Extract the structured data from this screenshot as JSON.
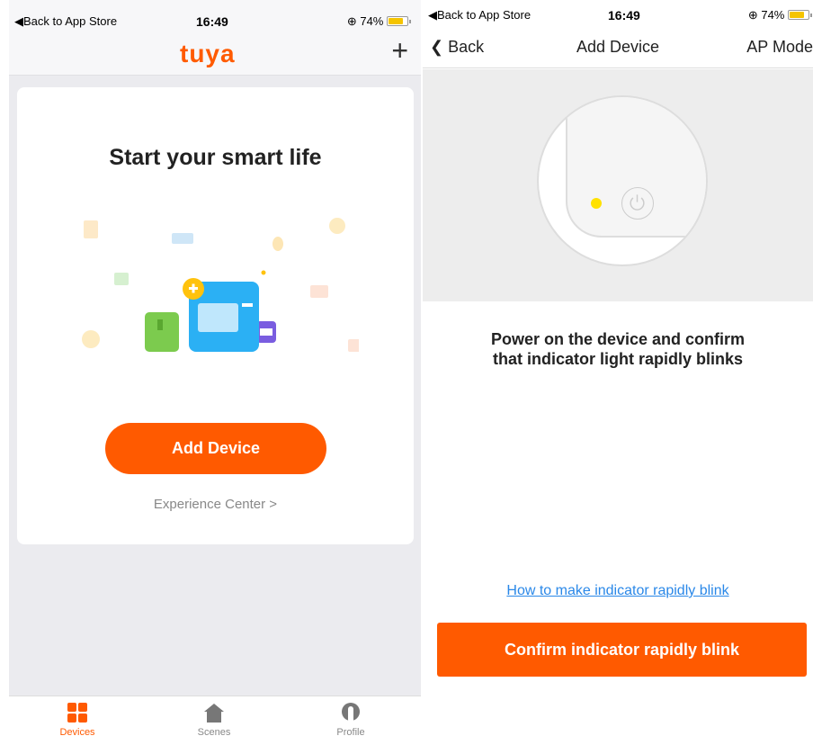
{
  "left": {
    "status": {
      "back": "◀Back to App Store",
      "time": "16:49",
      "battery": "74%"
    },
    "header": {
      "logo": "tuya",
      "plus": "+"
    },
    "card": {
      "title": "Start your smart life",
      "add_device": "Add Device",
      "experience": "Experience Center >"
    },
    "tabs": [
      {
        "label": "Devices",
        "icon": "devices-grid-icon"
      },
      {
        "label": "Scenes",
        "icon": "home-icon"
      },
      {
        "label": "Profile",
        "icon": "profile-icon"
      }
    ]
  },
  "right": {
    "status": {
      "back": "◀Back to App Store",
      "time": "16:49",
      "battery": "74%"
    },
    "nav": {
      "back": "Back",
      "title": "Add Device",
      "mode": "AP Mode"
    },
    "instruction_line1": "Power on the device and confirm",
    "instruction_line2": "that indicator light rapidly blinks",
    "help_link": "How to make indicator rapidly blink",
    "confirm_button": "Confirm indicator rapidly blink"
  },
  "colors": {
    "accent": "#ff5a00",
    "link": "#2a88e8",
    "indicator": "#ffe100"
  }
}
